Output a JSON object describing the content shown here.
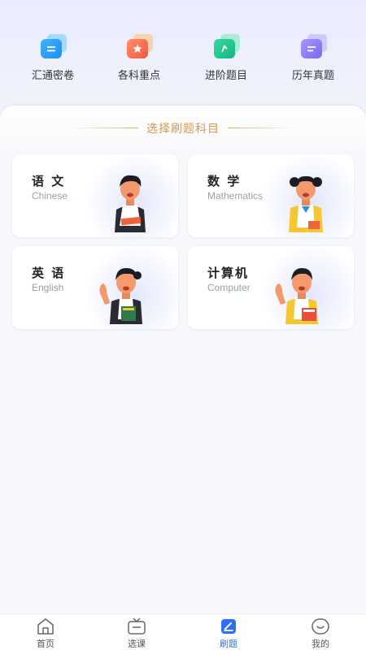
{
  "quick_nav": [
    {
      "label": "汇通密卷",
      "icon": "document-lines-icon",
      "color": "#2ea0f5"
    },
    {
      "label": "各科重点",
      "icon": "star-card-icon",
      "color": "#f56a53"
    },
    {
      "label": "进阶题目",
      "icon": "arrow-card-icon",
      "color": "#1fca8f"
    },
    {
      "label": "历年真题",
      "icon": "list-card-icon",
      "color": "#8b7bf3"
    }
  ],
  "section": {
    "title": "选择刷题科目"
  },
  "subjects": [
    {
      "cn": "语 文",
      "en": "Chinese"
    },
    {
      "cn": "数 学",
      "en": "Mathematics"
    },
    {
      "cn": "英 语",
      "en": "English"
    },
    {
      "cn": "计算机",
      "en": "Computer"
    }
  ],
  "tabbar": {
    "active_color": "#2f6df6",
    "items": [
      {
        "label": "首页",
        "icon": "home-icon"
      },
      {
        "label": "选课",
        "icon": "tv-icon"
      },
      {
        "label": "刷题",
        "icon": "pen-icon",
        "active": true
      },
      {
        "label": "我的",
        "icon": "smile-face-icon"
      }
    ]
  }
}
